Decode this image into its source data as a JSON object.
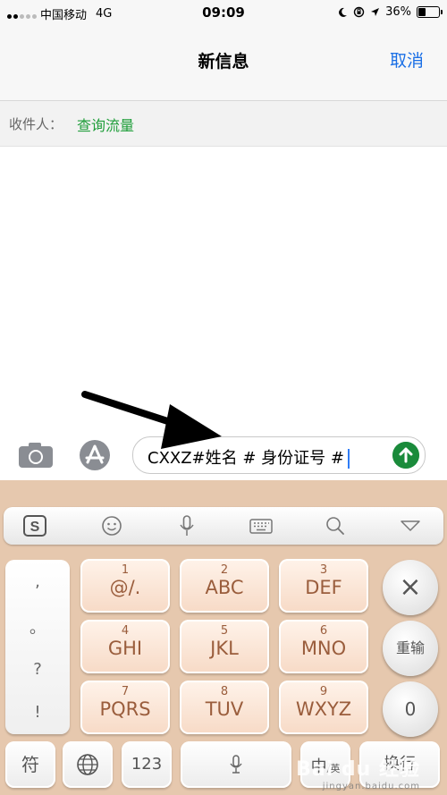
{
  "status": {
    "carrier": "中国移动",
    "network": "4G",
    "time": "09:09",
    "battery": "36%"
  },
  "nav": {
    "title": "新信息",
    "cancel": "取消"
  },
  "recipient": {
    "label": "收件人：",
    "name": "查询流量"
  },
  "message": {
    "text": "CXXZ#姓名 # 身份证号 #"
  },
  "keyboard": {
    "punct": [
      ",",
      "。",
      "?",
      "!"
    ],
    "keys": [
      {
        "num": "1",
        "txt": "@/."
      },
      {
        "num": "2",
        "txt": "ABC"
      },
      {
        "num": "3",
        "txt": "DEF"
      },
      {
        "num": "4",
        "txt": "GHI"
      },
      {
        "num": "5",
        "txt": "JKL"
      },
      {
        "num": "6",
        "txt": "MNO"
      },
      {
        "num": "7",
        "txt": "PQRS"
      },
      {
        "num": "8",
        "txt": "TUV"
      },
      {
        "num": "9",
        "txt": "WXYZ"
      }
    ],
    "delete": "×",
    "retype": "重输",
    "zero": "0",
    "symbol": "符",
    "numbers": "123",
    "lang_main": "中",
    "lang_sub": "/英",
    "enter": "换行"
  },
  "watermark": {
    "main": "Bai du 经验",
    "sub": "jingyan.baidu.com"
  },
  "colors": {
    "accent": "#1a6fe6",
    "send": "#1a8b3b",
    "recipient": "#1f9e3a",
    "keyboard_bg": "#e6c8ae"
  },
  "icons": {
    "camera": "camera-icon",
    "appstore": "app-store-icon",
    "send": "send-arrow-icon"
  }
}
